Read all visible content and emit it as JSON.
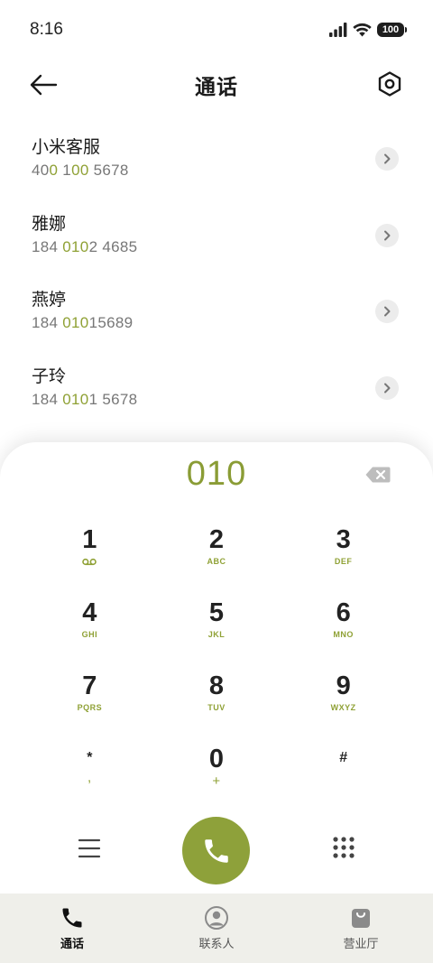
{
  "status_bar": {
    "time": "8:16",
    "battery": "100"
  },
  "header": {
    "title": "通话"
  },
  "contacts": [
    {
      "name": "小米客服",
      "number_parts": [
        {
          "t": "40",
          "hl": false
        },
        {
          "t": "0",
          "hl": true
        },
        {
          "t": " 1",
          "hl": false
        },
        {
          "t": "00",
          "hl": true
        },
        {
          "t": " 5678",
          "hl": false
        }
      ]
    },
    {
      "name": "雅娜",
      "number_parts": [
        {
          "t": "184 ",
          "hl": false
        },
        {
          "t": "010",
          "hl": true
        },
        {
          "t": "2 4685",
          "hl": false
        }
      ]
    },
    {
      "name": "燕婷",
      "number_parts": [
        {
          "t": "184 ",
          "hl": false
        },
        {
          "t": "010",
          "hl": true
        },
        {
          "t": "15689",
          "hl": false
        }
      ]
    },
    {
      "name": "子玲",
      "number_parts": [
        {
          "t": "184 ",
          "hl": false
        },
        {
          "t": "010",
          "hl": true
        },
        {
          "t": "1 5678",
          "hl": false
        }
      ]
    }
  ],
  "dialpad": {
    "display": "010",
    "keys": [
      {
        "digit": "1",
        "letters": "",
        "icon": "voicemail-icon"
      },
      {
        "digit": "2",
        "letters": "ABC"
      },
      {
        "digit": "3",
        "letters": "DEF"
      },
      {
        "digit": "4",
        "letters": "GHI"
      },
      {
        "digit": "5",
        "letters": "JKL"
      },
      {
        "digit": "6",
        "letters": "MNO"
      },
      {
        "digit": "7",
        "letters": "PQRS"
      },
      {
        "digit": "8",
        "letters": "TUV"
      },
      {
        "digit": "9",
        "letters": "WXYZ"
      },
      {
        "digit": "*",
        "letters": ",",
        "small": true
      },
      {
        "digit": "0",
        "letters": "+"
      },
      {
        "digit": "#",
        "letters": "",
        "small": true
      }
    ]
  },
  "bottom_nav": [
    {
      "label": "通话",
      "icon": "phone-icon",
      "active": true
    },
    {
      "label": "联系人",
      "icon": "contacts-icon",
      "active": false
    },
    {
      "label": "营业厅",
      "icon": "shopping-bag-icon",
      "active": false
    }
  ],
  "colors": {
    "accent": "#8ea13a",
    "highlight": "#8fa135",
    "nav_bg": "#efefea"
  }
}
